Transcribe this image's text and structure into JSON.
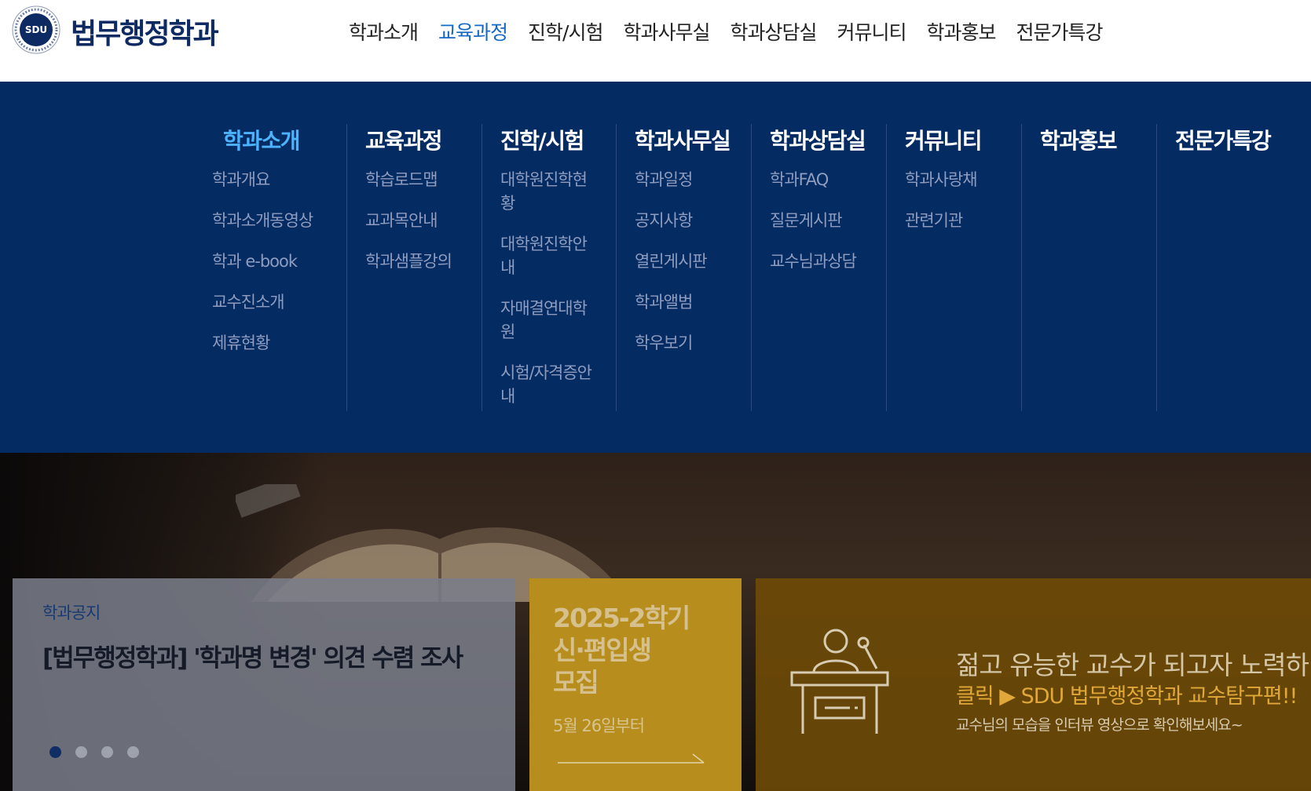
{
  "header": {
    "logo_text": "SDU",
    "title": "법무행정학과",
    "nav": [
      {
        "label": "학과소개",
        "active": false
      },
      {
        "label": "교육과정",
        "active": true
      },
      {
        "label": "진학/시험",
        "active": false
      },
      {
        "label": "학과사무실",
        "active": false
      },
      {
        "label": "학과상담실",
        "active": false
      },
      {
        "label": "커뮤니티",
        "active": false
      },
      {
        "label": "학과홍보",
        "active": false
      },
      {
        "label": "전문가특강",
        "active": false
      }
    ]
  },
  "mega_menu": [
    {
      "title": "학과소개",
      "items": [
        "학과개요",
        "학과소개동영상",
        "학과 e-book",
        "교수진소개",
        "제휴현황"
      ]
    },
    {
      "title": "교육과정",
      "items": [
        "학습로드맵",
        "교과목안내",
        "학과샘플강의"
      ]
    },
    {
      "title": "진학/시험",
      "items": [
        "대학원진학현황",
        "대학원진학안내",
        "자매결연대학원",
        "시험/자격증안내"
      ]
    },
    {
      "title": "학과사무실",
      "items": [
        "학과일정",
        "공지사항",
        "열린게시판",
        "학과앨범",
        "학우보기"
      ]
    },
    {
      "title": "학과상담실",
      "items": [
        "학과FAQ",
        "질문게시판",
        "교수님과상담"
      ]
    },
    {
      "title": "커뮤니티",
      "items": [
        "학과사랑채",
        "관련기관"
      ]
    },
    {
      "title": "학과홍보",
      "items": []
    },
    {
      "title": "전문가특강",
      "items": []
    }
  ],
  "notice": {
    "label": "학과공지",
    "title": "[법무행정학과] '학과명 변경' 의견 수렴 조사",
    "slide_count": 4,
    "active_slide": 1
  },
  "admission": {
    "title_line1": "2025-2학기",
    "title_line2": "신·편입생",
    "title_line3": "모집",
    "date": "5월 26일부터"
  },
  "professor": {
    "line1": "젊고 유능한 교수가 되고자 노력하",
    "line2": "클릭 ▶ SDU 법무행정학과 교수탐구편!!",
    "line3": "교수님의 모습을 인터뷰 영상으로 확인해보세요~"
  },
  "colors": {
    "brand_navy": "#052b63",
    "nav_active": "#1668c7",
    "menu_title_active": "#4eb3ff",
    "admission_gold": "#b78d1e",
    "professor_brown": "#6c4a08"
  }
}
